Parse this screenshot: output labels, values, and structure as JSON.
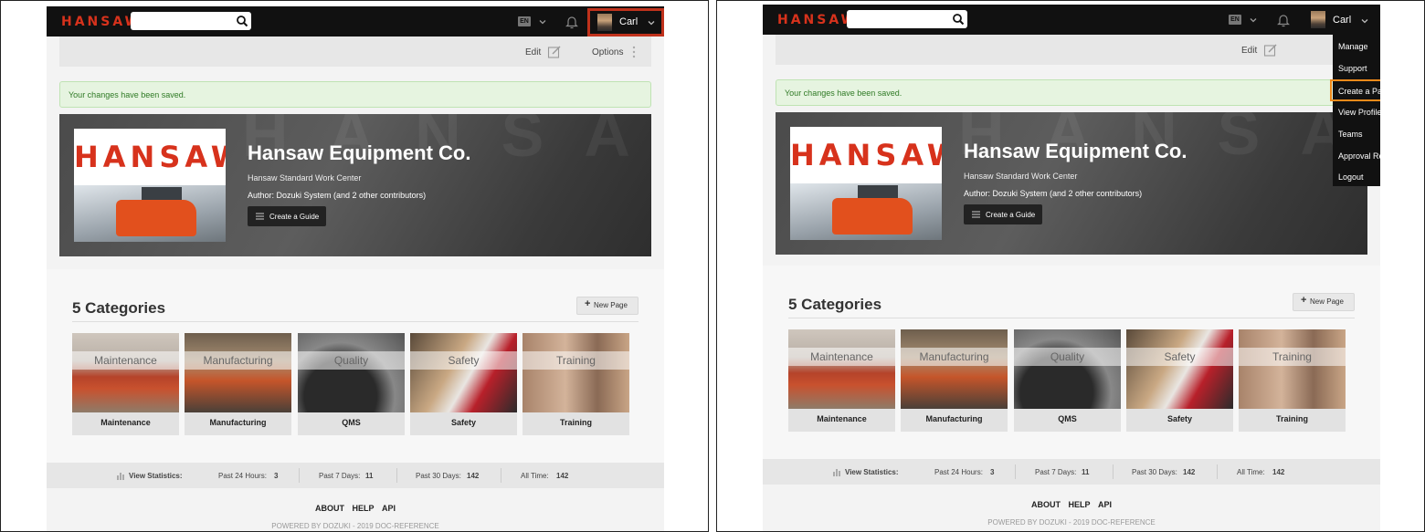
{
  "panels": [
    {
      "brand": "HANSAW",
      "search": {
        "placeholder": "",
        "value": ""
      },
      "language": "EN",
      "user": {
        "name": "Carl"
      },
      "toolbar": {
        "edit_label": "Edit",
        "options_label": "Options"
      },
      "notice": "Your changes have been saved.",
      "hero": {
        "title": "Hansaw Equipment Co.",
        "subtitle": "Hansaw Standard Work Center",
        "author": "Author: Dozuki System (and 2 other contributors)",
        "button": "Create a Guide",
        "thumb_brand": "HANSAW"
      },
      "categories": {
        "title": "5 Categories",
        "new_page": "New Page",
        "items": [
          {
            "band": "Maintenance",
            "label": "Maintenance"
          },
          {
            "band": "Manufacturing",
            "label": "Manufacturing"
          },
          {
            "band": "Quality",
            "label": "QMS"
          },
          {
            "band": "Safety",
            "label": "Safety"
          },
          {
            "band": "Training",
            "label": "Training"
          }
        ]
      },
      "stats": {
        "label": "View Statistics:",
        "past24_label": "Past 24 Hours:",
        "past24": "3",
        "past7_label": "Past 7 Days:",
        "past7": "11",
        "past30_label": "Past 30 Days:",
        "past30": "142",
        "all_label": "All Time:",
        "all": "142"
      },
      "footer": {
        "about": "ABOUT",
        "help": "HELP",
        "api": "API",
        "powered": "POWERED BY DOZUKI - 2019 DOC-REFERENCE"
      }
    }
  ],
  "dropdown": {
    "items": [
      "Manage",
      "Support",
      "Create a Page",
      "View Profile",
      "Teams",
      "Approval Requests",
      "Logout"
    ],
    "highlighted": "Create a Page"
  },
  "colors": {
    "brand_red": "#d7321c",
    "highlight_red": "#c0321c",
    "highlight_orange": "#f08a1a",
    "notice_green": "#2f7a25"
  }
}
